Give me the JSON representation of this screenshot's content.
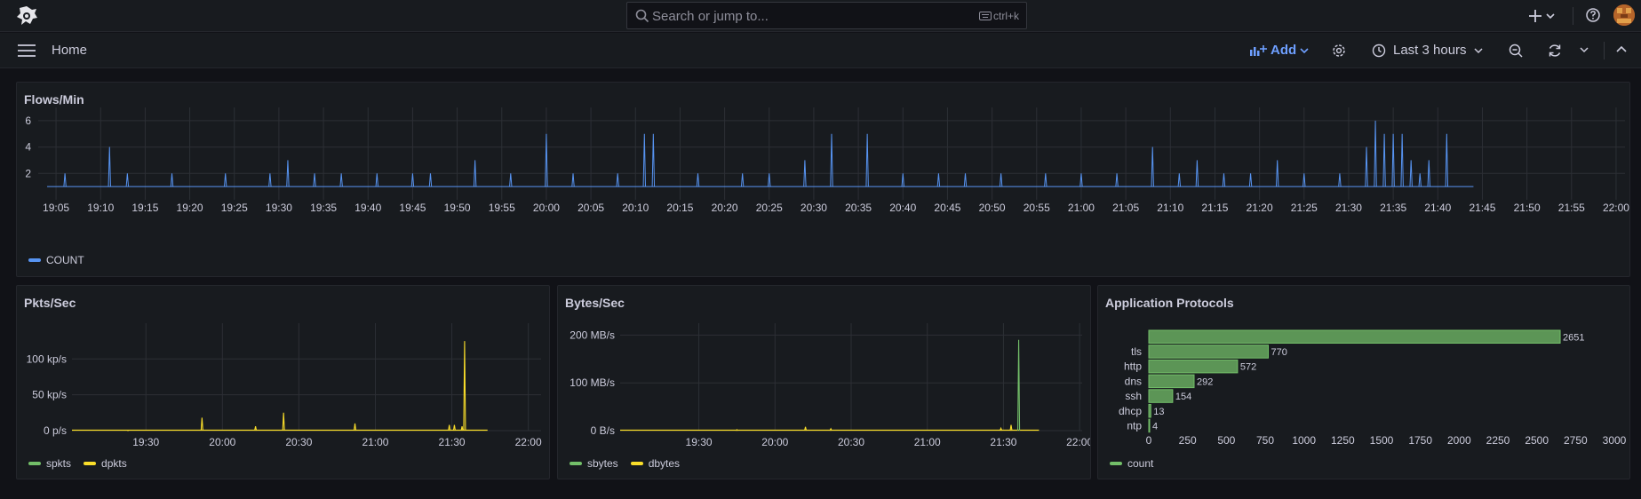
{
  "header": {
    "search_placeholder": "Search or jump to...",
    "search_shortcut": "ctrl+k"
  },
  "nav": {
    "breadcrumb": "Home",
    "add_label": "Add",
    "time_range": "Last 3 hours"
  },
  "colors": {
    "blue": "#5794f2",
    "green": "#73bf69",
    "yellow": "#fade2a",
    "accent": "#6e9fff"
  },
  "panels": {
    "flows": {
      "title": "Flows/Min",
      "legend": "COUNT"
    },
    "pkts": {
      "title": "Pkts/Sec",
      "legend": [
        "spkts",
        "dpkts"
      ]
    },
    "bytes": {
      "title": "Bytes/Sec",
      "legend": [
        "sbytes",
        "dbytes"
      ]
    },
    "protocols": {
      "title": "Application Protocols",
      "legend": "count"
    }
  },
  "chart_data": [
    {
      "type": "line",
      "title": "Flows/Min",
      "series": [
        {
          "name": "COUNT",
          "color": "#5794f2"
        }
      ],
      "x_ticks": [
        "19:05",
        "19:10",
        "19:15",
        "19:20",
        "19:25",
        "19:30",
        "19:35",
        "19:40",
        "19:45",
        "19:50",
        "19:55",
        "20:00",
        "20:05",
        "20:10",
        "20:15",
        "20:20",
        "20:25",
        "20:30",
        "20:35",
        "20:40",
        "20:45",
        "20:50",
        "20:55",
        "21:00",
        "21:05",
        "21:10",
        "21:15",
        "21:20",
        "21:25",
        "21:30",
        "21:35",
        "21:40",
        "21:45",
        "21:50",
        "21:55",
        "22:00"
      ],
      "x_range": [
        "19:03",
        "22:01"
      ],
      "data_end": "21:44",
      "y_ticks": [
        2,
        4,
        6
      ],
      "ylim": [
        0,
        7
      ],
      "spikes": [
        [
          "19:06",
          2
        ],
        [
          "19:11",
          4
        ],
        [
          "19:13",
          2
        ],
        [
          "19:18",
          2
        ],
        [
          "19:24",
          2
        ],
        [
          "19:29",
          2
        ],
        [
          "19:31",
          3
        ],
        [
          "19:34",
          2
        ],
        [
          "19:37",
          2
        ],
        [
          "19:41",
          2
        ],
        [
          "19:45",
          2
        ],
        [
          "19:47",
          2
        ],
        [
          "19:52",
          3
        ],
        [
          "19:56",
          2
        ],
        [
          "20:00",
          5
        ],
        [
          "20:03",
          2
        ],
        [
          "20:08",
          2
        ],
        [
          "20:11",
          5
        ],
        [
          "20:12",
          5
        ],
        [
          "20:17",
          2
        ],
        [
          "20:22",
          2
        ],
        [
          "20:25",
          2
        ],
        [
          "20:29",
          3
        ],
        [
          "20:32",
          5
        ],
        [
          "20:36",
          5
        ],
        [
          "20:40",
          2
        ],
        [
          "20:44",
          2
        ],
        [
          "20:47",
          2
        ],
        [
          "20:51",
          2
        ],
        [
          "20:56",
          2
        ],
        [
          "21:00",
          2
        ],
        [
          "21:04",
          2
        ],
        [
          "21:08",
          4
        ],
        [
          "21:11",
          2
        ],
        [
          "21:13",
          3
        ],
        [
          "21:16",
          2
        ],
        [
          "21:19",
          2
        ],
        [
          "21:22",
          3
        ],
        [
          "21:25",
          2
        ],
        [
          "21:29",
          2
        ],
        [
          "21:32",
          4
        ],
        [
          "21:33",
          6
        ],
        [
          "21:34",
          5
        ],
        [
          "21:35",
          5
        ],
        [
          "21:36",
          5
        ],
        [
          "21:37",
          3
        ],
        [
          "21:38",
          2
        ],
        [
          "21:39",
          3
        ],
        [
          "21:41",
          5
        ]
      ]
    },
    {
      "type": "line",
      "title": "Pkts/Sec",
      "series": [
        {
          "name": "spkts",
          "color": "#73bf69"
        },
        {
          "name": "dpkts",
          "color": "#fade2a"
        }
      ],
      "x_ticks": [
        "19:30",
        "20:00",
        "20:30",
        "21:00",
        "21:30",
        "22:00"
      ],
      "x_range": [
        "19:01",
        "22:05"
      ],
      "data_end": "21:44",
      "y_ticks": [
        "0 p/s",
        "50 kp/s",
        "100 kp/s"
      ],
      "ylim": [
        0,
        140
      ],
      "spikes": [
        [
          "19:23",
          0.5,
          "dpkts"
        ],
        [
          "19:52",
          18,
          "dpkts"
        ],
        [
          "20:13",
          6,
          "dpkts"
        ],
        [
          "20:24",
          25,
          "dpkts"
        ],
        [
          "20:52",
          10,
          "dpkts"
        ],
        [
          "21:29",
          8,
          "dpkts"
        ],
        [
          "21:31",
          8,
          "dpkts"
        ],
        [
          "21:34",
          6,
          "dpkts"
        ],
        [
          "21:35",
          125,
          "dpkts"
        ]
      ]
    },
    {
      "type": "line",
      "title": "Bytes/Sec",
      "series": [
        {
          "name": "sbytes",
          "color": "#73bf69"
        },
        {
          "name": "dbytes",
          "color": "#fade2a"
        }
      ],
      "x_ticks": [
        "19:30",
        "20:00",
        "20:30",
        "21:00",
        "21:30",
        "22:00"
      ],
      "x_range": [
        "18:59",
        "22:01"
      ],
      "data_end": "21:44",
      "y_ticks": [
        "0 B/s",
        "100 MB/s",
        "200 MB/s"
      ],
      "ylim": [
        0,
        210
      ],
      "spikes": [
        [
          "19:45",
          2,
          "dbytes"
        ],
        [
          "20:12",
          8,
          "dbytes"
        ],
        [
          "20:22",
          4,
          "dbytes"
        ],
        [
          "21:29",
          5,
          "dbytes"
        ],
        [
          "21:33",
          12,
          "dbytes"
        ],
        [
          "21:36",
          190,
          "sbytes"
        ]
      ]
    },
    {
      "type": "bar",
      "title": "Application Protocols",
      "orientation": "horizontal",
      "categories": [
        "",
        "tls",
        "http",
        "dns",
        "ssh",
        "dhcp",
        "ntp"
      ],
      "values": [
        2651,
        770,
        572,
        292,
        154,
        13,
        4
      ],
      "series": [
        {
          "name": "count",
          "color": "#73bf69"
        }
      ],
      "x_ticks": [
        0,
        250,
        500,
        750,
        1000,
        1250,
        1500,
        1750,
        2000,
        2250,
        2500,
        2750,
        3000
      ],
      "xlim": [
        0,
        3000
      ]
    }
  ]
}
